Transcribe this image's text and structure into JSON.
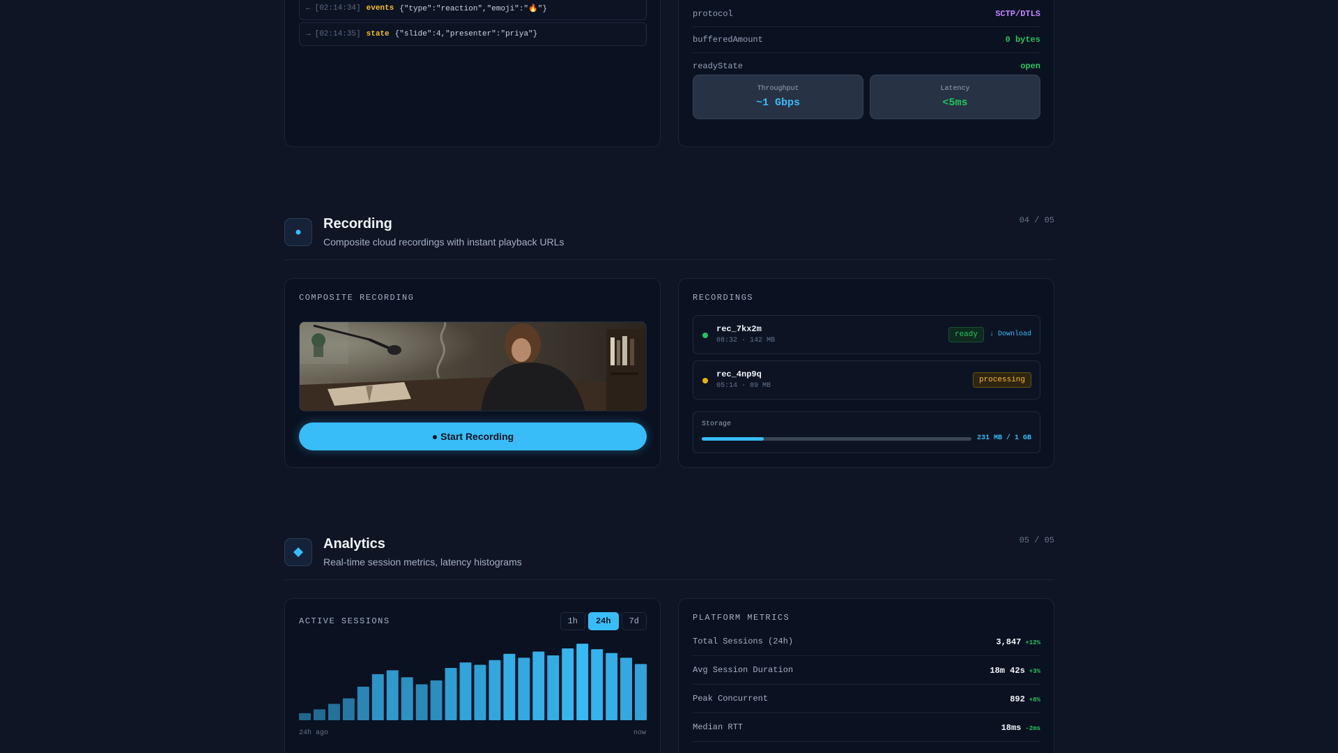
{
  "colors": {
    "accent": "#38bdf8",
    "success": "#22c55e",
    "warning": "#fbbf24",
    "purple": "#c084fc"
  },
  "log": [
    {
      "dir": "←",
      "time": "[02:14:34]",
      "channel": "events",
      "payload": "{\"type\":\"reaction\",\"emoji\":\"🔥\"}"
    },
    {
      "dir": "→",
      "time": "[02:14:35]",
      "channel": "state",
      "payload": "{\"slide\":4,\"presenter\":\"priya\"}"
    }
  ],
  "datachannel": {
    "rows": [
      {
        "key": "protocol",
        "value": "SCTP/DTLS",
        "color": "#c084fc"
      },
      {
        "key": "bufferedAmount",
        "value": "0 bytes",
        "color": "#22c55e"
      },
      {
        "key": "readyState",
        "value": "open",
        "color": "#22c55e"
      }
    ],
    "stats": [
      {
        "label": "Throughput",
        "value": "~1 Gbps",
        "color": "#38bdf8"
      },
      {
        "label": "Latency",
        "value": "<5ms",
        "color": "#22c55e"
      }
    ]
  },
  "recording": {
    "title": "Recording",
    "subtitle": "Composite cloud recordings with instant playback URLs",
    "count": "04 / 05",
    "composite_label": "COMPOSITE RECORDING",
    "start_label": "● Start Recording",
    "list_label": "RECORDINGS",
    "items": [
      {
        "id": "rec_7kx2m",
        "meta": "08:32 · 142 MB",
        "status": "ready",
        "dot": "#22c55e",
        "download": "↓ Download"
      },
      {
        "id": "rec_4np9q",
        "meta": "05:14 · 89 MB",
        "status": "processing",
        "dot": "#eab308",
        "download": ""
      }
    ],
    "storage": {
      "label": "Storage",
      "value": "231 MB / 1 GB",
      "fraction": 0.231
    }
  },
  "analytics": {
    "title": "Analytics",
    "subtitle": "Real-time session metrics, latency histograms",
    "count": "05 / 05",
    "sessions_label": "ACTIVE SESSIONS",
    "ranges": [
      "1h",
      "24h",
      "7d"
    ],
    "active_range": "24h",
    "metrics_label": "PLATFORM METRICS",
    "metrics": [
      {
        "label": "Total Sessions (24h)",
        "value": "3,847",
        "delta": "+12%"
      },
      {
        "label": "Avg Session Duration",
        "value": "18m 42s",
        "delta": "+3%"
      },
      {
        "label": "Peak Concurrent",
        "value": "892",
        "delta": "+8%"
      },
      {
        "label": "Median RTT",
        "value": "18ms",
        "delta": "-2ms"
      }
    ]
  },
  "chart_data": {
    "type": "bar",
    "x_start_label": "24h ago",
    "x_end_label": "now",
    "values": [
      9,
      14,
      21,
      28,
      43,
      59,
      64,
      55,
      46,
      51,
      67,
      74,
      71,
      77,
      85,
      80,
      88,
      83,
      92,
      98,
      91,
      86,
      80,
      72
    ],
    "ylim": [
      0,
      100
    ]
  }
}
